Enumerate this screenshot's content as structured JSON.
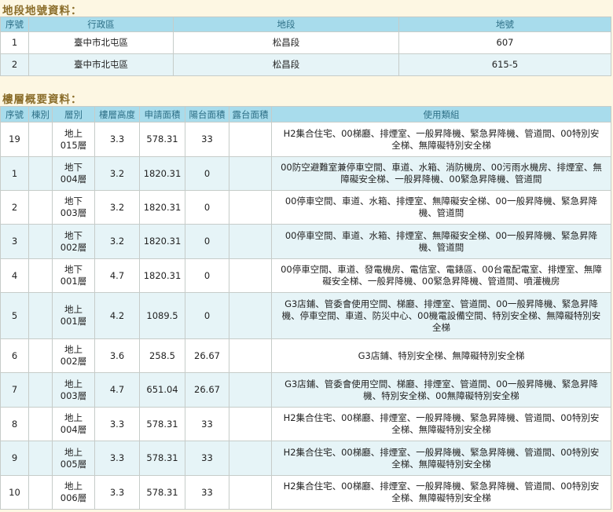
{
  "land_section": {
    "title": "地段地號資料：",
    "headers": [
      "序號",
      "行政區",
      "地段",
      "地號"
    ],
    "rows": [
      [
        "1",
        "臺中市北屯區",
        "松昌段",
        "607"
      ],
      [
        "2",
        "臺中市北屯區",
        "松昌段",
        "615-5"
      ]
    ]
  },
  "floor_section": {
    "title": "樓層概要資料：",
    "headers": [
      "序號",
      "棟別",
      "層別",
      "樓層高度",
      "申請面積",
      "陽台面積",
      "露台面積",
      "使用類組"
    ],
    "rows": [
      [
        "19",
        "",
        "地上\n015層",
        "3.3",
        "578.31",
        "33",
        "",
        "H2集合住宅、00梯廳、排煙室、一般昇降機、緊急昇降機、管道間、00特別安全梯、無障礙特別安全梯"
      ],
      [
        "1",
        "",
        "地下\n004層",
        "3.2",
        "1820.31",
        "0",
        "",
        "00防空避難室兼停車空間、車道、水箱、消防機房、00污雨水機房、排煙室、無障礙安全梯、一般昇降機、00緊急昇降機、管道間"
      ],
      [
        "2",
        "",
        "地下\n003層",
        "3.2",
        "1820.31",
        "0",
        "",
        "00停車空間、車道、水箱、排煙室、無障礙安全梯、00一般昇降機、緊急昇降機、管道間"
      ],
      [
        "3",
        "",
        "地下\n002層",
        "3.2",
        "1820.31",
        "0",
        "",
        "00停車空間、車道、水箱、排煙室、無障礙安全梯、00一般昇降機、緊急昇降機、管道間"
      ],
      [
        "4",
        "",
        "地下\n001層",
        "4.7",
        "1820.31",
        "0",
        "",
        "00停車空間、車道、發電機房、電信室、電錶區、00台電配電室、排煙室、無障礙安全梯、一般昇降機、00緊急昇降機、管道間、噴灌機房"
      ],
      [
        "5",
        "",
        "地上\n001層",
        "4.2",
        "1089.5",
        "0",
        "",
        "G3店鋪、管委會使用空間、梯廳、排煙室、管道間、00一般昇降機、緊急昇降機、停車空間、車道、防災中心、00機電設備空間、特別安全梯、無障礙特別安全梯"
      ],
      [
        "6",
        "",
        "地上\n002層",
        "3.6",
        "258.5",
        "26.67",
        "",
        "G3店鋪、特別安全梯、無障礙特別安全梯"
      ],
      [
        "7",
        "",
        "地上\n003層",
        "4.7",
        "651.04",
        "26.67",
        "",
        "G3店鋪、管委會使用空間、梯廳、排煙室、管道間、00一般昇降機、緊急昇降機、特別安全梯、00無障礙特別安全梯"
      ],
      [
        "8",
        "",
        "地上\n004層",
        "3.3",
        "578.31",
        "33",
        "",
        "H2集合住宅、00梯廳、排煙室、一般昇降機、緊急昇降機、管道間、00特別安全梯、無障礙特別安全梯"
      ],
      [
        "9",
        "",
        "地上\n005層",
        "3.3",
        "578.31",
        "33",
        "",
        "H2集合住宅、00梯廳、排煙室、一般昇降機、緊急昇降機、管道間、00特別安全梯、無障礙特別安全梯"
      ],
      [
        "10",
        "",
        "地上\n006層",
        "3.3",
        "578.31",
        "33",
        "",
        "H2集合住宅、00梯廳、排煙室、一般昇降機、緊急昇降機、管道間、00特別安全梯、無障礙特別安全梯"
      ]
    ]
  },
  "colors": {
    "header_bg": "#a8dcec",
    "header_text": "#2d6f86",
    "title_text": "#8a6d2a",
    "row_alt_bg": "#e6f4f7",
    "page_bg": "#fdf7e3"
  }
}
